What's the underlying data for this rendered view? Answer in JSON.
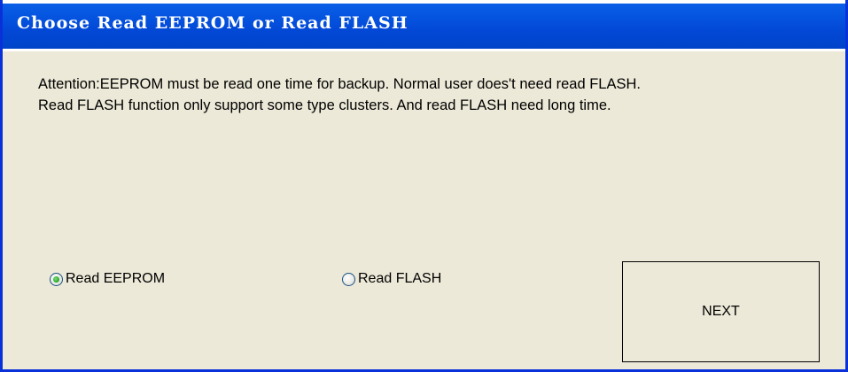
{
  "window": {
    "title": "Choose Read EEPROM or Read FLASH"
  },
  "message": {
    "line1": "Attention:EEPROM must be read one time for backup. Normal user does't need read FLASH.",
    "line2": "Read FLASH function only support some type clusters. And read FLASH need long time."
  },
  "options": {
    "eeprom": {
      "label": "Read EEPROM",
      "selected": true
    },
    "flash": {
      "label": "Read FLASH",
      "selected": false
    }
  },
  "buttons": {
    "next_label": "NEXT"
  },
  "colors": {
    "titlebar": "#0054e3",
    "window_bg": "#ece9d8",
    "radio_selected": "#21a121"
  }
}
